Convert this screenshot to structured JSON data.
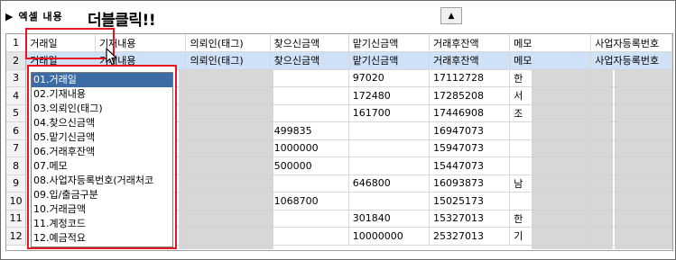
{
  "title": {
    "arrow": "▶",
    "text": "엑셀 내용"
  },
  "callout": "더블클릭!!",
  "collapse_button": "▲",
  "grid": {
    "header": [
      "거래일",
      "기재내용",
      "의뢰인(태그)",
      "찾으신금액",
      "맡기신금액",
      "거래후잔액",
      "메모",
      "사업자등록번호"
    ],
    "row2": [
      "거래일",
      "기재내용",
      "의뢰인(태그)",
      "찾으신금액",
      "맡기신금액",
      "거래후잔액",
      "메모",
      "사업자등록번호"
    ],
    "row_numbers": [
      "1",
      "2",
      "3",
      "4",
      "5",
      "6",
      "7",
      "8",
      "9",
      "10",
      "11",
      "12"
    ],
    "rows": [
      {
        "withdraw": "",
        "deposit": "97020",
        "balance": "17112728",
        "memo": "한"
      },
      {
        "withdraw": "",
        "deposit": "172480",
        "balance": "17285208",
        "memo": "서"
      },
      {
        "withdraw": "",
        "deposit": "161700",
        "balance": "17446908",
        "memo": "조"
      },
      {
        "withdraw": "499835",
        "deposit": "",
        "balance": "16947073",
        "memo": ""
      },
      {
        "withdraw": "1000000",
        "deposit": "",
        "balance": "15947073",
        "memo": ""
      },
      {
        "withdraw": "500000",
        "deposit": "",
        "balance": "15447073",
        "memo": ""
      },
      {
        "withdraw": "",
        "deposit": "646800",
        "balance": "16093873",
        "memo": "남"
      },
      {
        "withdraw": "1068700",
        "deposit": "",
        "balance": "15025173",
        "memo": ""
      },
      {
        "withdraw": "",
        "deposit": "301840",
        "balance": "15327013",
        "memo": "한"
      },
      {
        "withdraw": "",
        "deposit": "10000000",
        "balance": "25327013",
        "memo": "기"
      }
    ]
  },
  "dropdown": {
    "items": [
      "01.거래일",
      "02.기재내용",
      "03.의뢰인(태그)",
      "04.찾으신금액",
      "05.맡기신금액",
      "06.거래후잔액",
      "07.메모",
      "08.사업자등록번호(거래처코",
      "09.입/출금구분",
      "10.거래금액",
      "11.계정코드",
      "12.예금적요"
    ],
    "selected_index": 0
  },
  "colors": {
    "highlight": "#e8141f",
    "selected_row": "#cfe1f7",
    "dropdown_active": "#3d6ba6"
  }
}
